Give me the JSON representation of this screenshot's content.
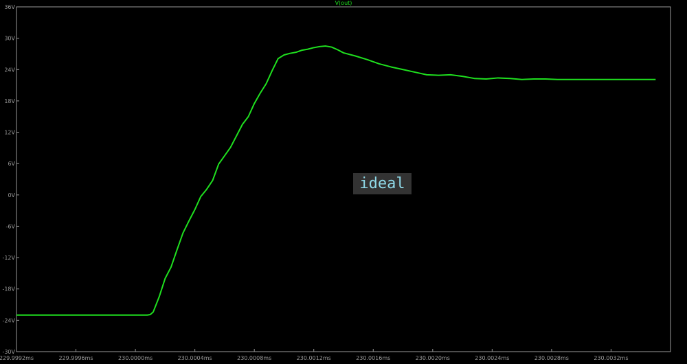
{
  "colors": {
    "background": "#000000",
    "frame": "#9a9a9a",
    "series": "#1fe01f",
    "label": "#9a9a9a"
  },
  "chart_data": {
    "type": "line",
    "title": "",
    "xlabel": "",
    "ylabel": "",
    "grid": false,
    "xlim": [
      229.9992,
      230.0036
    ],
    "ylim": [
      -30,
      36
    ],
    "x_ticks": [
      229.9992,
      229.9996,
      230.0,
      230.0004,
      230.0008,
      230.0012,
      230.0016,
      230.002,
      230.0024,
      230.0028,
      230.0032
    ],
    "x_tick_labels": [
      "229.9992ms",
      "229.9996ms",
      "230.0000ms",
      "230.0004ms",
      "230.0008ms",
      "230.0012ms",
      "230.0016ms",
      "230.0020ms",
      "230.0024ms",
      "230.0028ms",
      "230.0032ms"
    ],
    "y_ticks": [
      36,
      30,
      24,
      18,
      12,
      6,
      0,
      -6,
      -12,
      -18,
      -24,
      -30
    ],
    "y_tick_labels": [
      "36V",
      "30V",
      "24V",
      "18V",
      "12V",
      "6V",
      "0V",
      "-6V",
      "-12V",
      "-18V",
      "-24V",
      "-30V"
    ],
    "series": [
      {
        "name": "V(out)",
        "color": "#1fe01f",
        "x": [
          229.9992,
          229.9996,
          230.0,
          230.00008,
          230.0001,
          230.00012,
          230.00016,
          230.0002,
          230.00024,
          230.00028,
          230.00032,
          230.00036,
          230.0004,
          230.00044,
          230.00048,
          230.00052,
          230.00056,
          230.0006,
          230.00064,
          230.00068,
          230.00072,
          230.00076,
          230.0008,
          230.00084,
          230.00088,
          230.00092,
          230.00096,
          230.001,
          230.00104,
          230.00108,
          230.00112,
          230.00116,
          230.0012,
          230.00124,
          230.00128,
          230.00132,
          230.00136,
          230.0014,
          230.00148,
          230.00156,
          230.00164,
          230.00172,
          230.0018,
          230.00188,
          230.00196,
          230.00204,
          230.00212,
          230.0022,
          230.00228,
          230.00236,
          230.00244,
          230.00252,
          230.0026,
          230.00268,
          230.00276,
          230.00284,
          230.00292,
          230.003,
          230.0032,
          230.0034,
          230.0035
        ],
        "y": [
          -23.0,
          -23.0,
          -23.0,
          -23.0,
          -22.9,
          -22.4,
          -19.5,
          -16.0,
          -13.8,
          -10.5,
          -7.3,
          -5.0,
          -2.8,
          -0.3,
          1.1,
          2.8,
          5.9,
          7.5,
          9.1,
          11.3,
          13.5,
          15.0,
          17.5,
          19.5,
          21.3,
          23.8,
          26.1,
          26.8,
          27.1,
          27.3,
          27.7,
          27.9,
          28.2,
          28.4,
          28.5,
          28.3,
          27.8,
          27.2,
          26.6,
          25.9,
          25.1,
          24.5,
          24.0,
          23.5,
          23.0,
          22.9,
          23.0,
          22.7,
          22.3,
          22.2,
          22.4,
          22.3,
          22.1,
          22.2,
          22.2,
          22.1,
          22.1,
          22.1,
          22.1,
          22.1,
          22.1
        ]
      }
    ],
    "annotations": [
      {
        "text": "ideal"
      }
    ]
  }
}
